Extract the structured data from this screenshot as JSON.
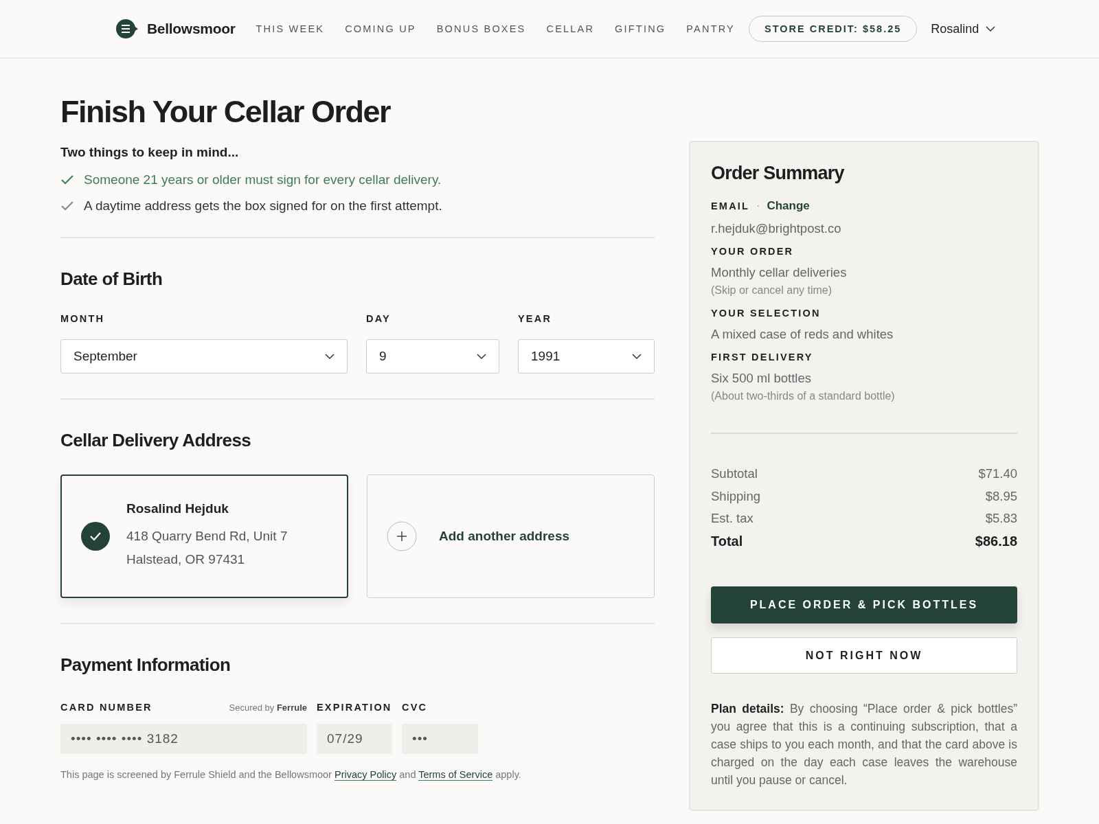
{
  "header": {
    "brand": "Bellowsmoor",
    "nav": [
      "THIS WEEK",
      "COMING UP",
      "BONUS BOXES",
      "CELLAR",
      "GIFTING",
      "PANTRY"
    ],
    "store_credit": "STORE CREDIT: $58.25",
    "user": "Rosalind"
  },
  "page_title": "Finish Your Cellar Order",
  "reminders": {
    "heading": "Two things to keep in mind...",
    "items": [
      {
        "text": "Someone 21 years or older must sign for every cellar delivery.",
        "highlighted": true
      },
      {
        "text": "A daytime address gets the box signed for on the first attempt.",
        "highlighted": false
      }
    ]
  },
  "date_of_birth": {
    "heading": "Date of Birth",
    "fields": [
      {
        "label": "MONTH",
        "value": "September"
      },
      {
        "label": "DAY",
        "value": "9"
      },
      {
        "label": "YEAR",
        "value": "1991"
      }
    ]
  },
  "delivery_address": {
    "heading": "Cellar Delivery Address",
    "options": [
      {
        "kind": "address",
        "selected": true,
        "name": "Rosalind Hejduk",
        "lines": [
          "418 Quarry Bend Rd, Unit 7",
          "Halstead, OR 97431"
        ]
      },
      {
        "kind": "add",
        "selected": false,
        "label": "Add another address"
      }
    ]
  },
  "payment": {
    "heading": "Payment Information",
    "card_label": "CARD NUMBER",
    "secured_note": "Secured by **Ferrule**",
    "card_value": "•••• •••• •••• 3182",
    "expiration_label": "EXPIRATION",
    "expiration_value": "07/29",
    "cvc_label": "CVC",
    "cvc_value": "•••",
    "notice": {
      "before": "This page is screened by Ferrule Shield and the Bellowsmoor",
      "links": [
        "Privacy Policy",
        "Terms of Service"
      ],
      "joiner": "and",
      "after": "apply."
    }
  },
  "summary": {
    "title": "Order Summary",
    "email_label": "EMAIL",
    "separator": "·",
    "change_link": "Change",
    "email": "r.hejduk@brightpost.co",
    "sections": [
      {
        "label": "YOUR ORDER",
        "value": "Monthly cellar deliveries",
        "note": "(Skip or cancel any time)"
      },
      {
        "label": "YOUR SELECTION",
        "value": "A mixed case of reds and whites"
      },
      {
        "label": "FIRST DELIVERY",
        "value": "Six 500 ml bottles",
        "note": "(About two-thirds of a standard bottle)"
      }
    ],
    "totals": [
      {
        "label": "Subtotal",
        "value": "$71.40",
        "kind": "line"
      },
      {
        "label": "Shipping",
        "value": "$8.95",
        "kind": "line"
      },
      {
        "label": "Est. tax",
        "value": "$5.83",
        "kind": "line"
      },
      {
        "label": "Total",
        "value": "$86.18",
        "kind": "total"
      }
    ],
    "primary_button": "PLACE ORDER & PICK BOTTLES",
    "secondary_button": "NOT RIGHT NOW",
    "plan_details": "**Plan details:** By choosing “Place order & pick bottles” you agree that this is a continuing subscription, that a case ships to you each month, and that the card above is charged on the day each case leaves the warehouse until you pause or cancel."
  }
}
